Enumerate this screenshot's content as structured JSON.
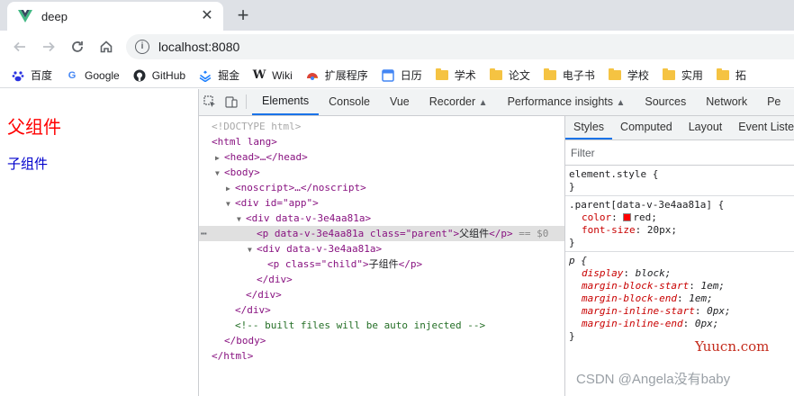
{
  "browser": {
    "tab_title": "deep",
    "new_tab": "+",
    "close": "✕",
    "url": "localhost:8080"
  },
  "bookmarks": [
    {
      "label": "百度",
      "icon": "baidu-icon"
    },
    {
      "label": "Google",
      "icon": "google-icon"
    },
    {
      "label": "GitHub",
      "icon": "github-icon"
    },
    {
      "label": "掘金",
      "icon": "juejin-icon"
    },
    {
      "label": "Wiki",
      "icon": "wikipedia-icon"
    },
    {
      "label": "扩展程序",
      "icon": "extension-icon"
    },
    {
      "label": "日历",
      "icon": "calendar-icon"
    },
    {
      "label": "学术",
      "icon": "folder-icon"
    },
    {
      "label": "论文",
      "icon": "folder-icon"
    },
    {
      "label": "电子书",
      "icon": "folder-icon"
    },
    {
      "label": "学校",
      "icon": "folder-icon"
    },
    {
      "label": "实用",
      "icon": "folder-icon"
    },
    {
      "label": "拓",
      "icon": "folder-icon"
    }
  ],
  "page": {
    "parent_text": "父组件",
    "child_text": "子组件",
    "parent_color": "#ff0000",
    "child_color": "#0000cc"
  },
  "devtools": {
    "tabs": [
      "Elements",
      "Console",
      "Vue",
      "Recorder",
      "Performance insights",
      "Sources",
      "Network",
      "Pe"
    ],
    "elements": {
      "doctype": "<!DOCTYPE html>",
      "html_open": "<html lang>",
      "head": "<head>…</head>",
      "body_open": "<body>",
      "noscript": "<noscript>…</noscript>",
      "div_app": "<div id=\"app\">",
      "div_scoped": "<div data-v-3e4aa81a>",
      "p_parent_open": "<p data-v-3e4aa81a class=\"parent\">",
      "p_parent_text": "父组件",
      "p_close": "</p>",
      "selected_marker": "== $0",
      "div_scoped2": "<div data-v-3e4aa81a>",
      "p_child_open": "<p class=\"child\">",
      "p_child_text": "子组件",
      "div_close": "</div>",
      "comment": "<!-- built files will be auto injected -->",
      "body_close": "</body>",
      "html_close": "</html>"
    },
    "styles_tabs": [
      "Styles",
      "Computed",
      "Layout",
      "Event Listene"
    ],
    "filter_placeholder": "Filter",
    "rules": {
      "element_style": "element.style {",
      "close": "}",
      "parent_selector": ".parent[data-v-3e4aa81a] {",
      "parent_props": [
        {
          "name": "color",
          "value": "red;"
        },
        {
          "name": "font-size",
          "value": "20px;"
        }
      ],
      "p_selector": "p {",
      "p_props": [
        {
          "name": "display",
          "value": "block;"
        },
        {
          "name": "margin-block-start",
          "value": "1em;"
        },
        {
          "name": "margin-block-end",
          "value": "1em;"
        },
        {
          "name": "margin-inline-start",
          "value": "0px;"
        },
        {
          "name": "margin-inline-end",
          "value": "0px;"
        }
      ]
    }
  },
  "watermarks": {
    "site": "Yuucn.com",
    "author": "CSDN @Angela没有baby"
  }
}
